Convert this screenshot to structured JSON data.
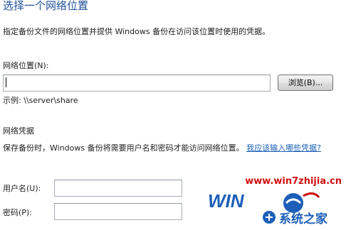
{
  "header": {
    "title": "选择一个网络位置",
    "description": "指定备份文件的网络位置并提供 Windows 备份在访问该位置时使用的凭据。"
  },
  "network_location": {
    "label": "网络位置(N):",
    "value": "",
    "browse_label": "浏览(B)...",
    "example": "示例: \\\\server\\share"
  },
  "credentials": {
    "heading": "网络凭据",
    "description": "保存备份时，Windows 备份将需要用户名和密码才能访问网络位置。",
    "help_link": "我应该输入哪些凭据?",
    "username_label": "用户名(U):",
    "username_value": "",
    "password_label": "密码(P):",
    "password_value": ""
  },
  "watermark": {
    "url": "www.win7zhijia.cn",
    "site_name": "系统之家"
  },
  "colors": {
    "title": "#1d4f9a",
    "link": "#1a5fb4",
    "watermark_red": "#d01010",
    "watermark_blue": "#1d5fb8"
  }
}
